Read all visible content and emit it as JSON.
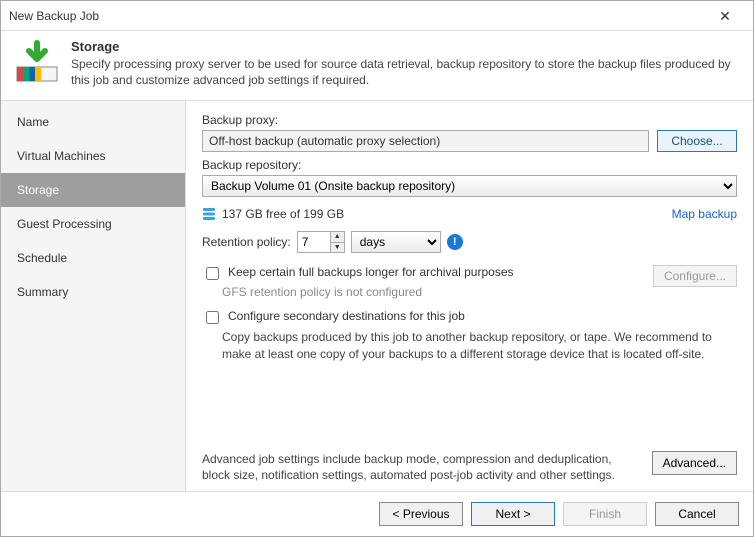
{
  "window": {
    "title": "New Backup Job"
  },
  "header": {
    "title": "Storage",
    "subtitle": "Specify processing proxy server to be used for source data retrieval, backup repository to store the backup files produced by this job and customize advanced job settings if required."
  },
  "sidebar": {
    "items": [
      {
        "label": "Name"
      },
      {
        "label": "Virtual Machines"
      },
      {
        "label": "Storage"
      },
      {
        "label": "Guest Processing"
      },
      {
        "label": "Schedule"
      },
      {
        "label": "Summary"
      }
    ],
    "activeIndex": 2
  },
  "proxy": {
    "label": "Backup proxy:",
    "value": "Off-host backup (automatic proxy selection)",
    "chooseLabel": "Choose..."
  },
  "repo": {
    "label": "Backup repository:",
    "value": "Backup Volume 01 (Onsite backup repository)",
    "freeText": "137 GB free of 199 GB",
    "mapLabel": "Map backup"
  },
  "retention": {
    "label": "Retention policy:",
    "value": "7",
    "unit": "days"
  },
  "gfs": {
    "checkboxLabel": "Keep certain full backups longer for archival purposes",
    "subtext": "GFS retention policy is not configured",
    "configureLabel": "Configure..."
  },
  "secondary": {
    "checkboxLabel": "Configure secondary destinations for this job",
    "desc": "Copy backups produced by this job to another backup repository, or tape. We recommend to make at least one copy of your backups to a different storage device that is located off-site."
  },
  "advanced": {
    "desc": "Advanced job settings include backup mode, compression and deduplication, block size, notification settings, automated post-job activity and other settings.",
    "buttonLabel": "Advanced..."
  },
  "footer": {
    "previous": "< Previous",
    "next": "Next >",
    "finish": "Finish",
    "cancel": "Cancel"
  }
}
